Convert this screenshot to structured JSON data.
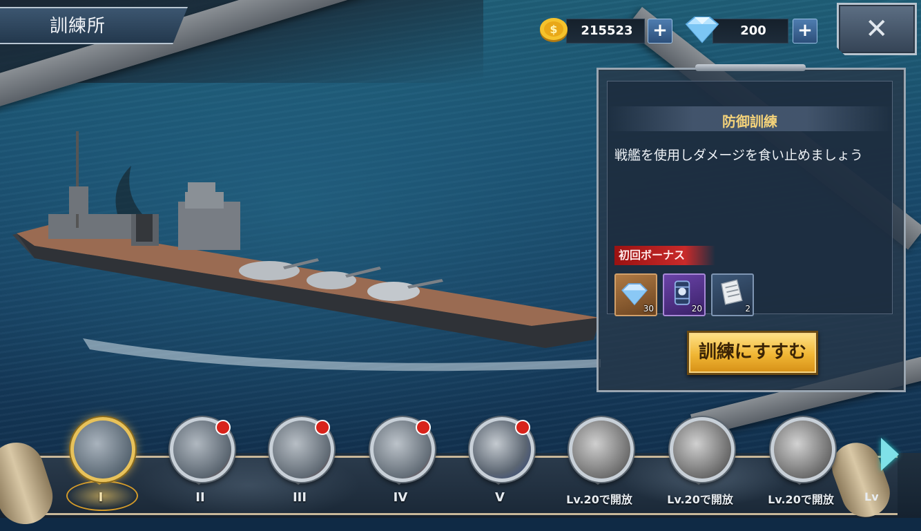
{
  "header": {
    "title": "訓練所"
  },
  "resources": {
    "gold": {
      "icon": "coin-icon",
      "value": "215523"
    },
    "gems": {
      "icon": "diamond-icon",
      "value": "200"
    },
    "add_label": "+"
  },
  "close_label": "✕",
  "panel": {
    "title": "防御訓練",
    "description": "戦艦を使用しダメージを食い止めましょう",
    "bonus_label": "初回ボーナス",
    "rewards": [
      {
        "icon": "diamond-icon",
        "count": "30"
      },
      {
        "icon": "oil-barrel-icon",
        "count": "20"
      },
      {
        "icon": "blueprint-document-icon",
        "count": "2"
      }
    ],
    "action_label": "訓練にすすむ"
  },
  "stages": [
    {
      "label": "I",
      "state": "selected",
      "badge": false
    },
    {
      "label": "II",
      "state": "available",
      "badge": true
    },
    {
      "label": "III",
      "state": "available",
      "badge": true
    },
    {
      "label": "IV",
      "state": "available",
      "badge": true
    },
    {
      "label": "V",
      "state": "available",
      "badge": true
    },
    {
      "label": "Lv.20で開放",
      "state": "locked",
      "badge": false
    },
    {
      "label": "Lv.20で開放",
      "state": "locked",
      "badge": false
    },
    {
      "label": "Lv.20で開放",
      "state": "locked",
      "badge": false
    },
    {
      "label": "Lv",
      "state": "locked",
      "badge": false
    }
  ],
  "colors": {
    "accent_gold": "#f0b634",
    "bonus_red": "#c92a2a",
    "panel_title": "#f3d27a"
  }
}
